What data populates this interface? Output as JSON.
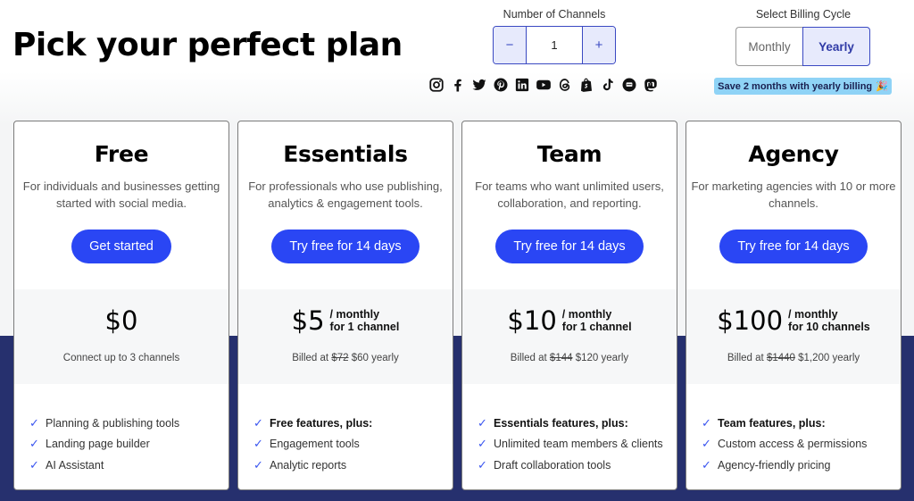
{
  "page": {
    "title": "Pick your perfect plan"
  },
  "channels": {
    "label": "Number of Channels",
    "minus_label": "−",
    "plus_label": "+",
    "value": "1"
  },
  "socials": [
    "instagram-icon",
    "facebook-icon",
    "twitter-icon",
    "pinterest-icon",
    "linkedin-icon",
    "youtube-icon",
    "threads-icon",
    "shopify-icon",
    "tiktok-icon",
    "google-business-icon",
    "mastodon-icon"
  ],
  "billing": {
    "label": "Select Billing Cycle",
    "options": [
      "Monthly",
      "Yearly"
    ],
    "selected": "Yearly",
    "save_badge": "Save 2 months with yearly billing",
    "save_emoji": "🎉"
  },
  "colors": {
    "accent": "#2a46f4",
    "band": "#26306e",
    "badge": "#8fd3f6"
  },
  "plans": [
    {
      "name": "Free",
      "description": "For individuals and businesses getting started with social media.",
      "cta": "Get started",
      "price": "$0",
      "unit_line1": "",
      "unit_line2": "",
      "billed_prefix": "",
      "billed_old": "",
      "billed_new": "Connect up to 3 channels",
      "features": [
        "Planning & publishing tools",
        "Landing page builder",
        "AI Assistant"
      ],
      "features_bold_first": false
    },
    {
      "name": "Essentials",
      "description": "For professionals who use publishing, analytics & engagement tools.",
      "cta": "Try free for 14 days",
      "price": "$5",
      "unit_line1": "/ monthly",
      "unit_line2": "for 1 channel",
      "billed_prefix": "Billed at",
      "billed_old": "$72",
      "billed_new": "$60 yearly",
      "features": [
        "Free features, plus:",
        "Engagement tools",
        "Analytic reports"
      ],
      "features_bold_first": true
    },
    {
      "name": "Team",
      "description": "For teams who want unlimited users, collaboration, and reporting.",
      "cta": "Try free for 14 days",
      "price": "$10",
      "unit_line1": "/ monthly",
      "unit_line2": "for 1 channel",
      "billed_prefix": "Billed at",
      "billed_old": "$144",
      "billed_new": "$120 yearly",
      "features": [
        "Essentials features, plus:",
        "Unlimited team members & clients",
        "Draft collaboration tools"
      ],
      "features_bold_first": true
    },
    {
      "name": "Agency",
      "description": "For marketing agencies with 10 or more channels.",
      "cta": "Try free for 14 days",
      "price": "$100",
      "unit_line1": "/ monthly",
      "unit_line2": "for 10 channels",
      "billed_prefix": "Billed at",
      "billed_old": "$1440",
      "billed_new": "$1,200 yearly",
      "features": [
        "Team features, plus:",
        "Custom access & permissions",
        "Agency-friendly pricing"
      ],
      "features_bold_first": true
    }
  ]
}
